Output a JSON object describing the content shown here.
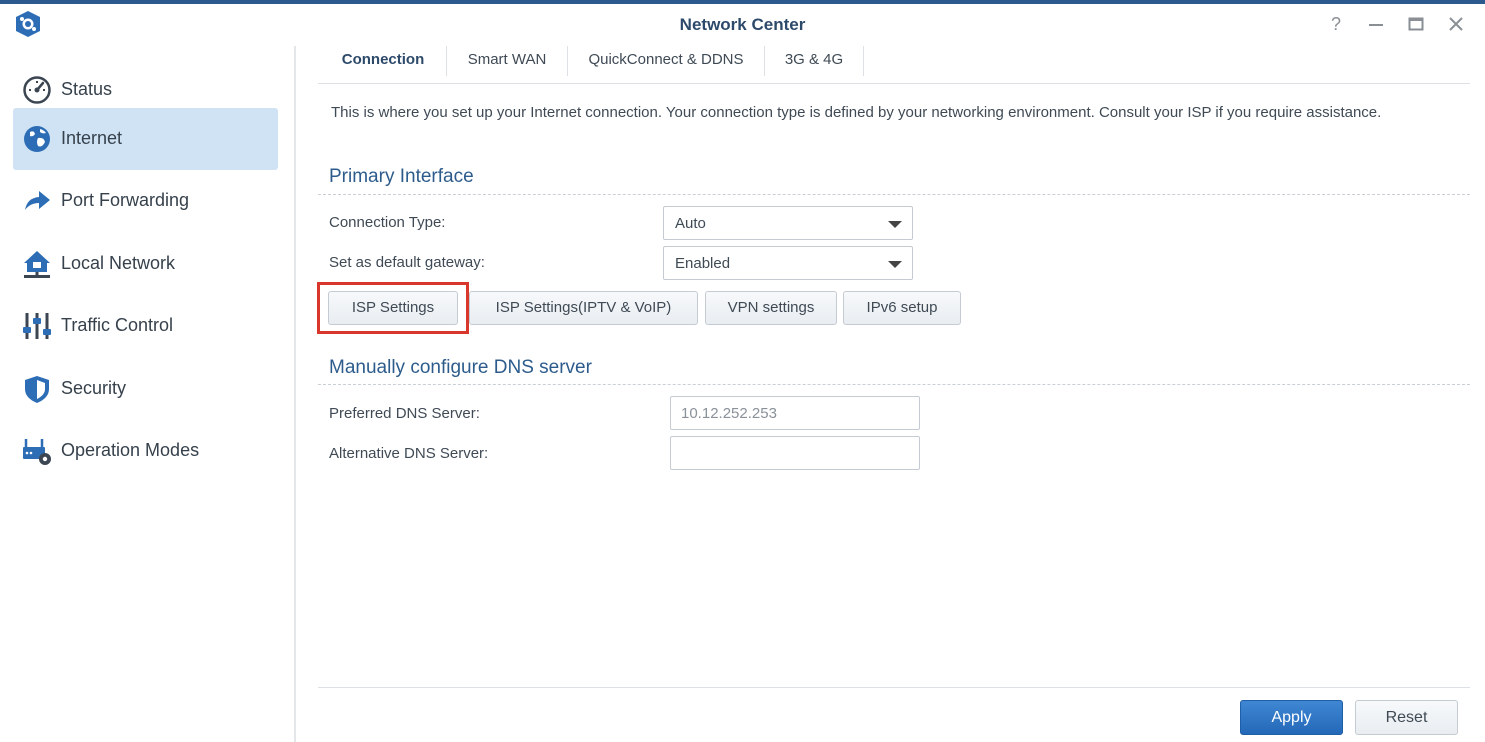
{
  "window": {
    "title": "Network Center",
    "controls": [
      "help-icon",
      "minimize-icon",
      "maximize-icon",
      "close-icon"
    ]
  },
  "sidebar": {
    "items": [
      {
        "label": "Status",
        "icon": "speedometer-icon",
        "active": false
      },
      {
        "label": "Internet",
        "icon": "globe-icon",
        "active": true
      },
      {
        "label": "Port Forwarding",
        "icon": "forward-arrow-icon",
        "active": false
      },
      {
        "label": "Local Network",
        "icon": "home-network-icon",
        "active": false
      },
      {
        "label": "Traffic Control",
        "icon": "sliders-icon",
        "active": false
      },
      {
        "label": "Security",
        "icon": "shield-icon",
        "active": false
      },
      {
        "label": "Operation Modes",
        "icon": "router-gear-icon",
        "active": false
      }
    ]
  },
  "tabs": [
    {
      "label": "Connection",
      "active": true
    },
    {
      "label": "Smart WAN",
      "active": false
    },
    {
      "label": "QuickConnect & DDNS",
      "active": false
    },
    {
      "label": "3G & 4G",
      "active": false
    }
  ],
  "main": {
    "description": "This is where you set up your Internet connection. Your connection type is defined by your networking environment. Consult your ISP if you require assistance.",
    "primary": {
      "title": "Primary Interface",
      "connection_type_label": "Connection Type:",
      "connection_type_value": "Auto",
      "gateway_label": "Set as default gateway:",
      "gateway_value": "Enabled"
    },
    "buttons": {
      "isp_settings": "ISP Settings",
      "isp_iptv": "ISP Settings(IPTV & VoIP)",
      "vpn": "VPN settings",
      "ipv6": "IPv6 setup"
    },
    "dns": {
      "title": "Manually configure DNS server",
      "preferred_label": "Preferred DNS Server:",
      "preferred_value": "10.12.252.253",
      "alternative_label": "Alternative DNS Server:",
      "alternative_value": ""
    }
  },
  "footer": {
    "apply": "Apply",
    "reset": "Reset"
  },
  "colors": {
    "accent": "#2369b8",
    "highlight_box": "#d9372b",
    "active_nav": "#cfe3f5"
  }
}
